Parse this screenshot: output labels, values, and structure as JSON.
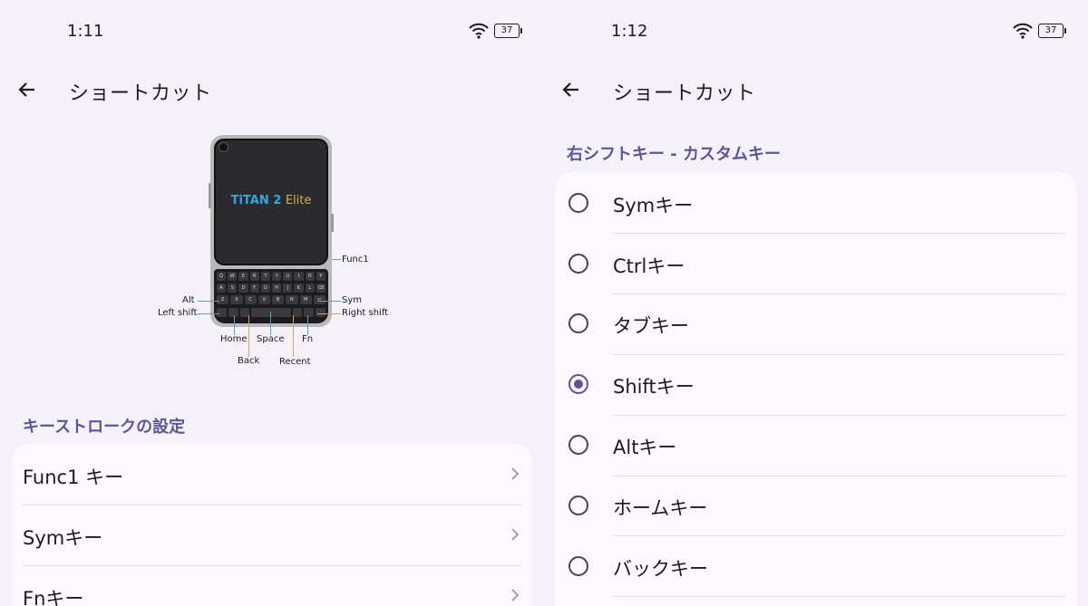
{
  "left": {
    "status_bar": {
      "time": "1:11",
      "battery": "37"
    },
    "app_bar": {
      "title": "ショートカット"
    },
    "device_image": {
      "brand_titan": "TiTAN 2",
      "brand_elite": "Elite",
      "callouts": {
        "func1": "Func1",
        "alt": "Alt",
        "left_shift": "Left shift",
        "sym": "Sym",
        "right_shift": "Right shift",
        "home": "Home",
        "space": "Space",
        "fn": "Fn",
        "back": "Back",
        "recent": "Recent"
      },
      "keys": {
        "row1": [
          "Q",
          "W",
          "E",
          "R",
          "T",
          "Y",
          "U",
          "I",
          "O",
          "P"
        ],
        "row2": [
          "A",
          "S",
          "D",
          "F",
          "G",
          "H",
          "J",
          "K",
          "L",
          "⌫"
        ],
        "row3": [
          "Z",
          "X",
          "C",
          "V",
          "B",
          "N",
          "M",
          "↵"
        ]
      }
    },
    "section_title": "キーストロークの設定",
    "items": [
      {
        "label": "Func1 キー"
      },
      {
        "label": "Symキー"
      },
      {
        "label": "Fnキー"
      }
    ]
  },
  "right": {
    "status_bar": {
      "time": "1:12",
      "battery": "37"
    },
    "app_bar": {
      "title": "ショートカット"
    },
    "section_title": "右シフトキー - カスタムキー",
    "options": [
      {
        "label": "Symキー",
        "selected": false
      },
      {
        "label": "Ctrlキー",
        "selected": false
      },
      {
        "label": "タブキー",
        "selected": false
      },
      {
        "label": "Shiftキー",
        "selected": true
      },
      {
        "label": "Altキー",
        "selected": false
      },
      {
        "label": "ホームキー",
        "selected": false
      },
      {
        "label": "バックキー",
        "selected": false
      }
    ]
  },
  "colors": {
    "accent": "#5b5797",
    "background": "#f4f1f8",
    "card": "#fbf8ff",
    "text": "#1d1b20"
  },
  "icons": {
    "back": "arrow-left-icon",
    "wifi": "wifi-icon",
    "battery": "battery-icon",
    "chevron": "chevron-right-icon"
  }
}
